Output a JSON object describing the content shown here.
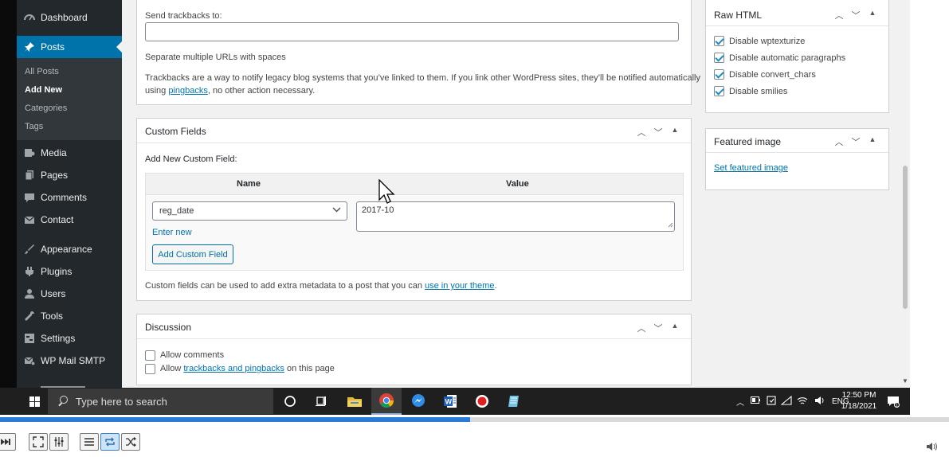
{
  "sidebar": {
    "items": [
      {
        "label": "Dashboard",
        "icon": "dashboard-icon"
      },
      {
        "label": "Posts",
        "icon": "pin-icon"
      },
      {
        "label": "Media",
        "icon": "media-icon"
      },
      {
        "label": "Pages",
        "icon": "pages-icon"
      },
      {
        "label": "Comments",
        "icon": "comments-icon"
      },
      {
        "label": "Contact",
        "icon": "mail-icon"
      },
      {
        "label": "Appearance",
        "icon": "brush-icon"
      },
      {
        "label": "Plugins",
        "icon": "plug-icon"
      },
      {
        "label": "Users",
        "icon": "users-icon"
      },
      {
        "label": "Tools",
        "icon": "wrench-icon"
      },
      {
        "label": "Settings",
        "icon": "settings-icon"
      },
      {
        "label": "WP Mail SMTP",
        "icon": "mail-smtp-icon"
      }
    ],
    "submenu": [
      "All Posts",
      "Add New",
      "Categories",
      "Tags"
    ]
  },
  "trackbacks": {
    "label": "Send trackbacks to:",
    "value": "",
    "hint": "Separate multiple URLs with spaces",
    "desc1": "Trackbacks are a way to notify legacy blog systems that you’ve linked to them. If you link other WordPress sites, they’ll be notified automatically",
    "desc2_pre": "using ",
    "desc2_link": "pingbacks",
    "desc2_post": ", no other action necessary."
  },
  "custom_fields": {
    "title": "Custom Fields",
    "add_new_label": "Add New Custom Field:",
    "col_name": "Name",
    "col_value": "Value",
    "name_select": "reg_date",
    "value_text": "2017-10",
    "enter_new": "Enter new",
    "add_button": "Add Custom Field",
    "footer_pre": "Custom fields can be used to add extra metadata to a post that you can ",
    "footer_link": "use in your theme",
    "footer_post": "."
  },
  "discussion": {
    "title": "Discussion",
    "allow_comments": "Allow comments",
    "allow_pre": "Allow ",
    "allow_link": "trackbacks and pingbacks",
    "allow_post": " on this page"
  },
  "raw_html": {
    "title": "Raw HTML",
    "options": [
      {
        "label": "Disable wptexturize",
        "checked": true
      },
      {
        "label": "Disable automatic paragraphs",
        "checked": true
      },
      {
        "label": "Disable convert_chars",
        "checked": true
      },
      {
        "label": "Disable smilies",
        "checked": true
      }
    ]
  },
  "featured_image": {
    "title": "Featured image",
    "link": "Set featured image"
  },
  "taskbar": {
    "search_placeholder": "Type here to search",
    "lang": "ENG",
    "time": "12:50 PM",
    "date": "1/18/2021"
  },
  "player": {
    "progress": 0.495
  }
}
